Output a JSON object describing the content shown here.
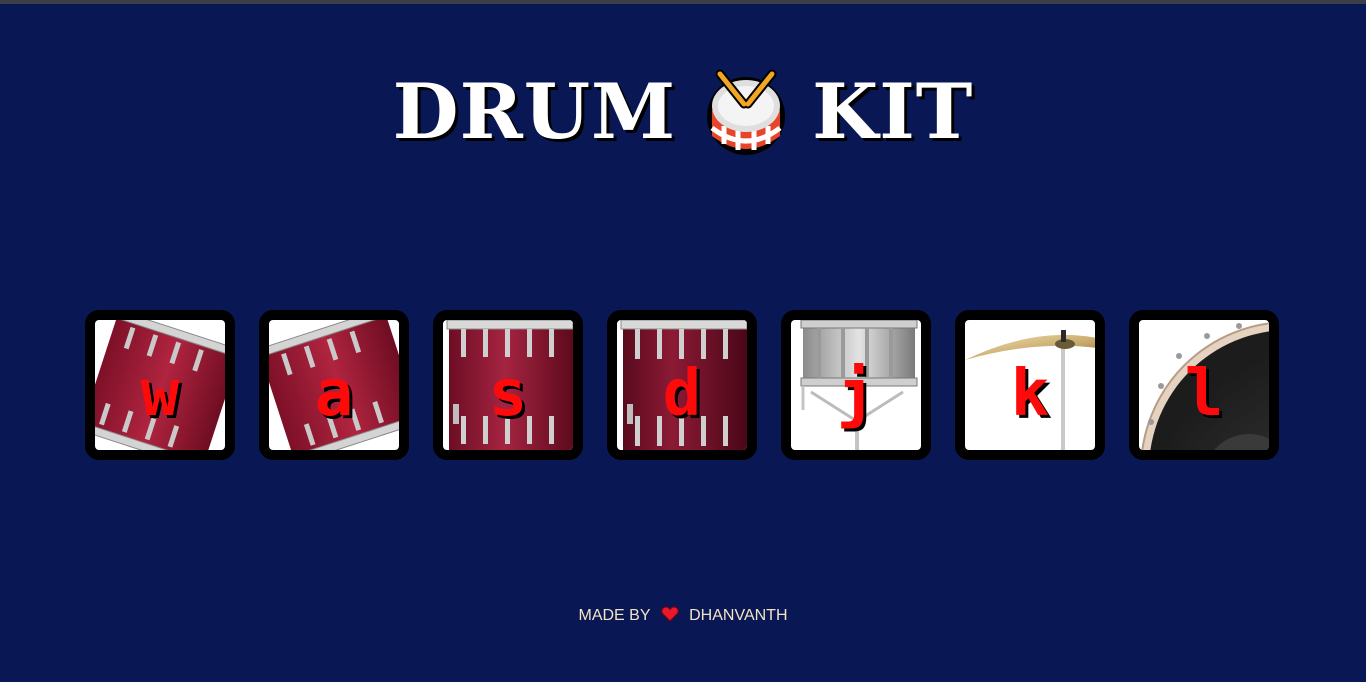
{
  "header": {
    "title_left": "DRUM",
    "title_right": "KIT",
    "emoji_icon": "drum-with-drumsticks"
  },
  "pads": [
    {
      "key": "w",
      "instrument_icon": "tom-1"
    },
    {
      "key": "a",
      "instrument_icon": "tom-2"
    },
    {
      "key": "s",
      "instrument_icon": "tom-3"
    },
    {
      "key": "d",
      "instrument_icon": "tom-4"
    },
    {
      "key": "j",
      "instrument_icon": "snare"
    },
    {
      "key": "k",
      "instrument_icon": "crash-cymbal"
    },
    {
      "key": "l",
      "instrument_icon": "kick-bass"
    }
  ],
  "footer": {
    "made_by": "MADE BY",
    "author": "DHANVANTH",
    "heart_icon": "heart"
  },
  "colors": {
    "background": "#091854",
    "key_text": "#ff0a0a",
    "drum_red": "#9c1a36",
    "footer_text": "#f1e3c6"
  }
}
